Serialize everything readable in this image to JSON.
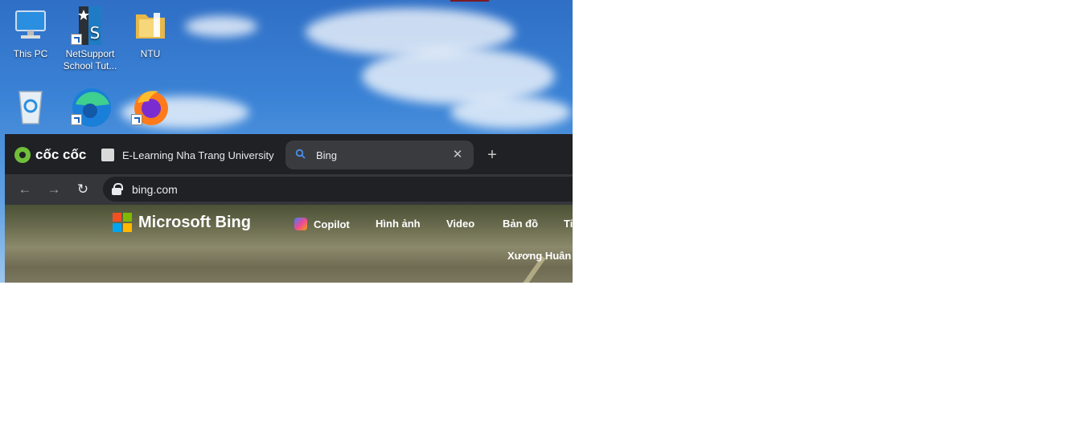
{
  "desktop": {
    "icons": [
      {
        "label": "This PC",
        "icon": "computer-icon"
      },
      {
        "label": "NetSupport School Tut...",
        "icon": "netsupport-icon"
      },
      {
        "label": "NTU",
        "icon": "folder-icon"
      },
      {
        "label": "",
        "icon": "recycle-bin-icon"
      },
      {
        "label": "",
        "icon": "edge-icon"
      },
      {
        "label": "",
        "icon": "firefox-icon"
      }
    ]
  },
  "browser": {
    "brand": "cốc cốc",
    "tabs": [
      {
        "title": "E-Learning Nha Trang University",
        "icon": "elearning-favicon"
      },
      {
        "title": "Bing",
        "icon": "search-favicon",
        "active": true
      }
    ],
    "address": "bing.com",
    "page": {
      "logo_text": "Microsoft Bing",
      "nav": [
        "Copilot",
        "Hình ảnh",
        "Video",
        "Bản đồ",
        "Ti"
      ],
      "user": "Xương Huân"
    }
  },
  "colors": {
    "bing_red": "#f25022",
    "bing_green": "#7fba00",
    "bing_blue": "#00a4ef",
    "bing_yellow": "#ffb900"
  }
}
